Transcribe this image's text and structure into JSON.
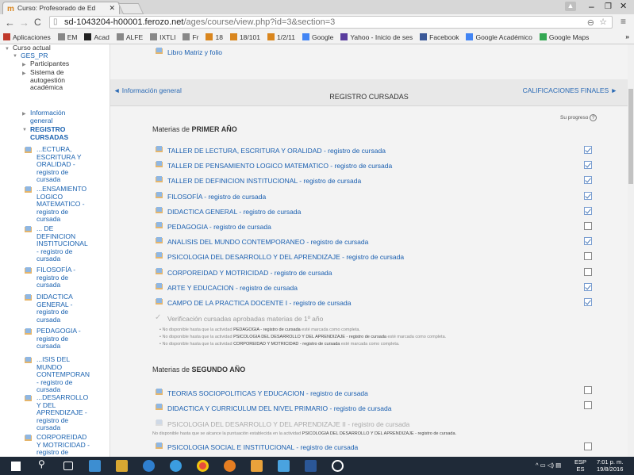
{
  "browser": {
    "tab_title": "Curso: Profesorado de Ed",
    "url_host": "sd-1043204-h00001.ferozo.net",
    "url_path": "/ages/course/view.php?id=3&section=3",
    "bookmarks": [
      "Aplicaciones",
      "EM",
      "Acad",
      "ALFE",
      "IXTLI",
      "Fr",
      "18",
      "18/101",
      "1/2/11",
      "Google",
      "Yahoo - Inicio de ses",
      "Facebook",
      "Google Académico",
      "Google Maps"
    ]
  },
  "sidebar": {
    "curso_actual": "Curso actual",
    "course": "GES_PR",
    "participantes": "Participantes",
    "sistema": [
      "Sistema de",
      "autogestión",
      "académica"
    ],
    "informacion": [
      "Información",
      "general"
    ],
    "registro": [
      "REGISTRO",
      "CURSADAS"
    ],
    "items": [
      [
        "...ECTURA,",
        "ESCRITURA Y",
        "ORALIDAD -",
        "registro de",
        "cursada"
      ],
      [
        "...ENSAMIENTO",
        "LOGICO",
        "MATEMATICO -",
        "registro de",
        "cursada"
      ],
      [
        "... DE",
        "DEFINICION",
        "INSTITUCIONAL",
        "- registro de",
        "cursada"
      ],
      [
        "FILOSOFÍA -",
        "registro de",
        "cursada"
      ],
      [
        "DIDACTICA",
        "GENERAL -",
        "registro de",
        "cursada"
      ],
      [
        "PEDAGOGIA -",
        "registro de",
        "cursada"
      ],
      [
        "...ISIS DEL",
        "MUNDO",
        "CONTEMPORAN",
        "- registro de",
        "cursada"
      ],
      [
        "...DESARROLLO",
        "Y DEL",
        "APRENDIZAJE -",
        "registro de",
        "cursada"
      ],
      [
        "CORPOREIDAD",
        "Y MOTRICIDAD -",
        "registro de"
      ]
    ]
  },
  "main": {
    "top_link": "Libro Matriz y folio",
    "prev_link": "◄ Información general",
    "section_title": "REGISTRO CURSADAS",
    "next_link": "CALIFICACIONES FINALES ►",
    "progress_label": "Su progreso",
    "year1_prefix": "Materias de ",
    "year1_bold": "PRIMER AÑO",
    "year1_items": [
      {
        "label": "TALLER DE LECTURA, ESCRITURA Y ORALIDAD - registro de cursada",
        "done": true
      },
      {
        "label": "TALLER DE PENSAMIENTO LOGICO MATEMATICO - registro de cursada",
        "done": true
      },
      {
        "label": "TALLER DE DEFINICION INSTITUCIONAL - registro de cursada",
        "done": true
      },
      {
        "label": "FILOSOFÍA - registro de cursada",
        "done": true
      },
      {
        "label": "DIDACTICA GENERAL - registro de cursada",
        "done": true
      },
      {
        "label": "PEDAGOGIA - registro de cursada",
        "done": false
      },
      {
        "label": "ANALISIS DEL MUNDO CONTEMPORANEO - registro de cursada",
        "done": true
      },
      {
        "label": "PSICOLOGIA DEL DESARROLLO Y DEL APRENDIZAJE - registro de cursada",
        "done": false
      },
      {
        "label": "CORPOREIDAD Y MOTRICIDAD - registro de cursada",
        "done": false
      },
      {
        "label": "ARTE Y EDUCACION - registro de cursada",
        "done": true
      },
      {
        "label": "CAMPO DE LA PRACTICA DOCENTE I - registro de cursada",
        "done": true
      }
    ],
    "verification": "Verificación cursadas aprobadas materias de 1º año",
    "restrictions": [
      {
        "pre": "No disponible hasta que la actividad ",
        "act": "PEDAGOGIA - registro de cursada",
        "post": " esté marcada como completa."
      },
      {
        "pre": "No disponible hasta que la actividad ",
        "act": "PSICOLOGIA DEL DESARROLLO Y DEL APRENDIZAJE - registro de cursada",
        "post": " esté marcada como completa."
      },
      {
        "pre": "No disponible hasta que la actividad ",
        "act": "CORPOREIDAD Y MOTRICIDAD - registro de cursada",
        "post": " esté marcada como completa."
      }
    ],
    "year2_prefix": "Materias de ",
    "year2_bold": "SEGUNDO AÑO",
    "year2_items": [
      {
        "label": "TEORIAS SOCIOPOLITICAS Y EDUCACION - registro de cursada",
        "done": false
      },
      {
        "label": "DIDACTICA Y CURRICULUM DEL NIVEL PRIMARIO - registro de cursada",
        "done": false
      }
    ],
    "year2_disabled": "PSICOLOGIA DEL DESARROLLO Y DEL APRENDIZAJE II - registro de cursada",
    "year2_restriction_pre": "No disponible hasta que se alcance la puntuación establecida en la actividad ",
    "year2_restriction_act": "PSICOLOGIA DEL DESARROLLO Y DEL APRENDIZAJE - registro de cursada.",
    "year2_last": "PSICOLOGIA SOCIAL E INSTITUCIONAL - registro de cursada"
  },
  "taskbar": {
    "lang": "ESP",
    "region": "ES",
    "time": "7:01 p. m.",
    "date": "19/8/2016"
  }
}
